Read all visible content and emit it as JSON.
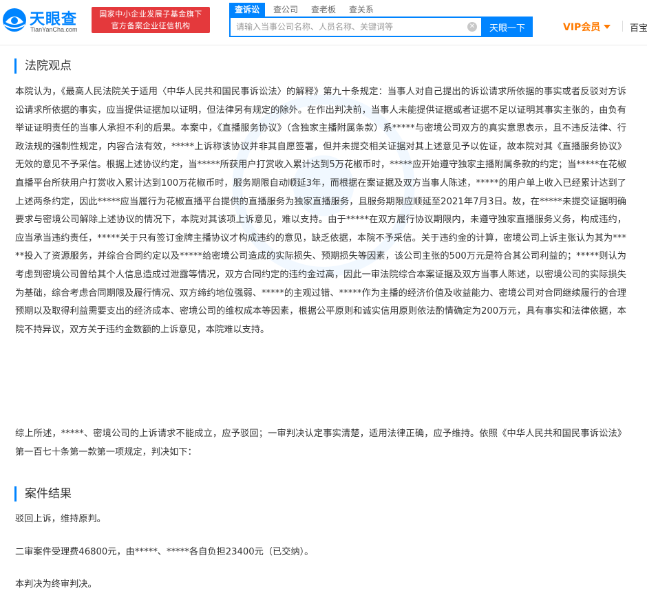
{
  "header": {
    "logo_name": "天眼查",
    "logo_domain": "TianYanCha.com",
    "badge_line1": "国家中小企业发展子基金旗下",
    "badge_line2": "官方备案企业征信机构",
    "search_tabs": [
      {
        "label": "查诉讼",
        "active": true
      },
      {
        "label": "查公司",
        "active": false
      },
      {
        "label": "查老板",
        "active": false
      },
      {
        "label": "查关系",
        "active": false
      }
    ],
    "search_placeholder": "请输入当事公司名称、人员名称、关键词等",
    "search_button": "天眼一下",
    "vip_label": "VIP会员",
    "nav_more": "百宝"
  },
  "colors": {
    "brand": "#0084ff",
    "badge": "#e4393c",
    "vip": "#ff7a00"
  },
  "sections": {
    "court_view": {
      "title": "法院观点",
      "paragraph1": "本院认为，《最高人民法院关于适用〈中华人民共和国民事诉讼法〉的解释》第九十条规定：当事人对自己提出的诉讼请求所依据的事实或者反驳对方诉讼请求所依据的事实，应当提供证据加以证明，但法律另有规定的除外。在作出判决前，当事人未能提供证据或者证据不足以证明其事实主张的，由负有举证证明责任的当事人承担不利的后果。本案中，《直播服务协议》（含独家主播附属条款）系*****与密境公司双方的真实意思表示，且不违反法律、行政法规的强制性规定，内容合法有效，*****上诉称该协议并非其自愿签署，但并未提交相关证据对其上述意见予以佐证，故本院对其《直播服务协议》无效的意见不予采信。根据上述协议约定，当*****所获用户打赏收入累计达到5万花椒币时，*****应开始遵守独家主播附属条款的约定；当*****在花椒直播平台所获用户打赏收入累计达到100万花椒币时，服务期限自动顺延3年，而根据在案证据及双方当事人陈述，*****的用户单上收入已经累计达到了上述两条约定，因此*****应当履行为花椒直播平台提供的直播服务为独家直播服务，且服务期限应顺延至2021年7月3日。故，在*****未提交证据明确要求与密境公司解除上述协议的情况下，本院对其该项上诉意见，难以支持。由于*****在双方履行协议期限内，未遵守独家直播服务义务，构成违约，应当承当违约责任，*****关于只有签订金牌主播协议才构成违约的意见，缺乏依据，本院不予采信。关于违约金的计算，密境公司上诉主张认为其为*****投入了资源服务，并综合合同约定以及*****给密境公司造成的实际损失、预期损失等因素，该公司主张的500万元是符合其公司利益的；*****则认为考虑到密境公司曾给其个人信息造成过泄露等情况，双方合同约定的违约金过高，因此一审法院综合本案证据及双方当事人陈述，以密境公司的实际损失为基础，综合考虑合同期限及履行情况、双方缔约地位强弱、*****的主观过错、*****作为主播的经济价值及收益能力、密境公司对合同继续履行的合理预期以及取得利益需要支出的经济成本、密境公司的维权成本等因素，根据公平原则和诚实信用原则依法酌情确定为200万元，具有事实和法律依据，本院不持异议，双方关于违约金数额的上诉意见，本院难以支持。",
      "paragraph2": "综上所述，*****、密境公司的上诉请求不能成立，应予驳回；一审判决认定事实清楚，适用法律正确，应予维持。依照《中华人民共和国民事诉讼法》第一百七十条第一款第一项规定，判决如下："
    },
    "case_result": {
      "title": "案件结果",
      "line1": "驳回上诉，维持原判。",
      "line2": "二审案件受理费46800元，由*****、*****各自负担23400元（已交纳）。",
      "line3": "本判决为终审判决。"
    }
  }
}
